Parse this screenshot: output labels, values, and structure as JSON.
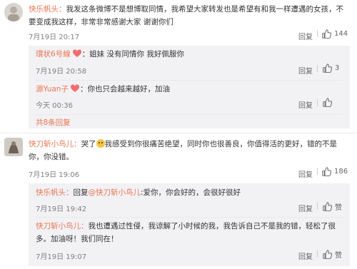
{
  "comments": [
    {
      "user": "快乐帆头：",
      "text": "我发这条微博不是想博取同情，我希望大家转发也是希望有和我一样遭遇的女孩，不要变成我这样，非常非常感谢大家 谢谢你们",
      "time": "7月19日 20:17",
      "reply_label": "回复",
      "like_count": "144"
    },
    {
      "user": "快刀斩小鸟儿：",
      "text_prefix": "哭了",
      "text": "我感受到你很痛苦绝望，同时你也很善良，你值得活的更好，错的不是你，你没错。",
      "time": "7月19日 19:06",
      "reply_label": "回复",
      "like_count": "186"
    }
  ],
  "replies_a": [
    {
      "user": "環状6号線",
      "text": "：姐妹 没有同情你 我好佩服你",
      "time": "7月19日 20:58",
      "reply_label": "回复",
      "like_count": "3"
    },
    {
      "user": "源Yuan子",
      "text": "：你也只会越来越好，加油",
      "time": "今天 00:36",
      "reply_label": "回复",
      "like_count": ""
    }
  ],
  "more_replies": "共8条回复",
  "replies_b": [
    {
      "user": "快乐帆头：",
      "text_prefix": "回复",
      "mention": "@快刀斩小鸟儿",
      "text": ":爱你，你会好的，会很好很好",
      "time": "7月19日 19:42",
      "reply_label": "回复",
      "like_label": "赞"
    },
    {
      "user": "快刀斩小鸟儿：",
      "text": "我也遭遇过性侵，我谅解了小时候的我，我告诉自己不是我的错，轻松了很多。加油呀！我们同在！",
      "time": "7月19日 19:07",
      "reply_label": "回复",
      "like_label": "赞"
    }
  ],
  "colors": {
    "username": "#eb7350",
    "reply_bg": "#f2f2f5",
    "meta": "#808080"
  }
}
